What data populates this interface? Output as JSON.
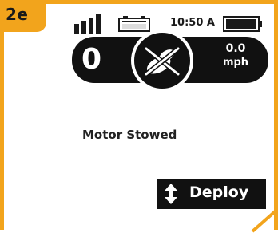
{
  "step": {
    "label": "2e"
  },
  "status": {
    "time": "10:50 A",
    "signal_icon": "signal-bars-icon",
    "battery_small_icon": "battery-icon",
    "battery_big_icon": "battery-full-icon"
  },
  "hud": {
    "left_value": "0",
    "center_icon": "motor-stowed-icon",
    "speed_value": "0.0",
    "speed_unit": "mph"
  },
  "main": {
    "status_text": "Motor Stowed"
  },
  "actions": {
    "deploy_label": "Deploy",
    "deploy_icon": "up-down-arrows-icon"
  },
  "colors": {
    "accent": "#f2a41c",
    "dark": "#111111",
    "background": "#ffffff"
  }
}
